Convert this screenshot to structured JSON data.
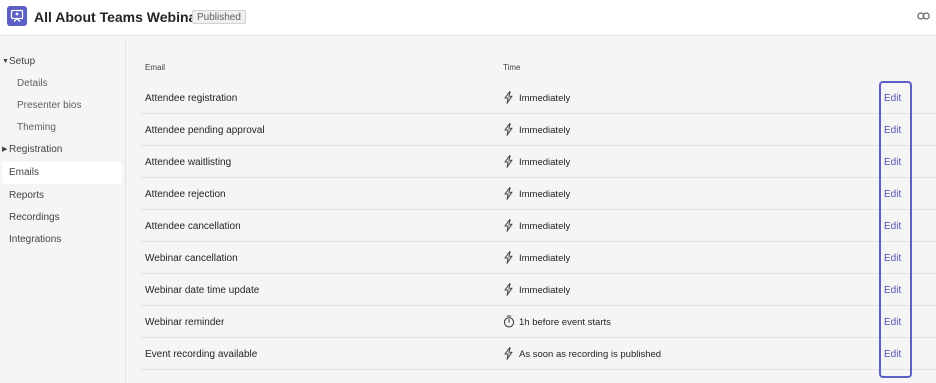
{
  "header": {
    "title": "All About Teams Webinars!",
    "status_badge": "Published",
    "app_icon": "webinar-icon",
    "link_icon": "link-icon"
  },
  "sidebar": {
    "items": [
      {
        "label": "Setup",
        "expanded": true
      },
      {
        "label": "Details"
      },
      {
        "label": "Presenter bios"
      },
      {
        "label": "Theming"
      },
      {
        "label": "Registration",
        "expanded": false
      },
      {
        "label": "Emails",
        "selected": true
      },
      {
        "label": "Reports"
      },
      {
        "label": "Recordings"
      },
      {
        "label": "Integrations"
      }
    ]
  },
  "table": {
    "columns": {
      "email": "Email",
      "time": "Time"
    },
    "edit_label": "Edit",
    "rows": [
      {
        "email": "Attendee registration",
        "time": "Immediately",
        "icon": "lightning-icon"
      },
      {
        "email": "Attendee pending approval",
        "time": "Immediately",
        "icon": "lightning-icon"
      },
      {
        "email": "Attendee waitlisting",
        "time": "Immediately",
        "icon": "lightning-icon"
      },
      {
        "email": "Attendee rejection",
        "time": "Immediately",
        "icon": "lightning-icon"
      },
      {
        "email": "Attendee cancellation",
        "time": "Immediately",
        "icon": "lightning-icon"
      },
      {
        "email": "Webinar cancellation",
        "time": "Immediately",
        "icon": "lightning-icon"
      },
      {
        "email": "Webinar date time update",
        "time": "Immediately",
        "icon": "lightning-icon"
      },
      {
        "email": "Webinar reminder",
        "time": "1h before event starts",
        "icon": "timer-icon"
      },
      {
        "email": "Event recording available",
        "time": "As soon as recording is published",
        "icon": "lightning-icon"
      }
    ]
  },
  "colors": {
    "accent": "#5b5fc7",
    "link": "#4f52b2",
    "background": "#f5f5f5"
  }
}
